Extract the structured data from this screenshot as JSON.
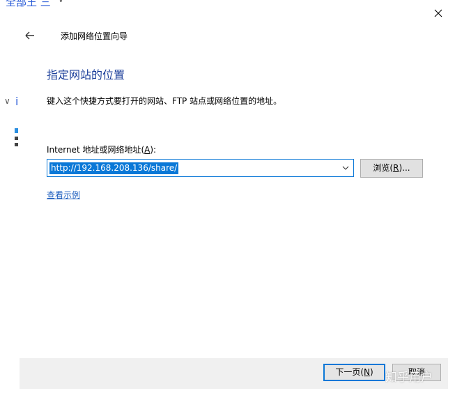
{
  "background_window": {
    "fragment_text": "全部王 三",
    "fragment_text_2": "i"
  },
  "dialog": {
    "title": "添加网络位置向导",
    "heading": "指定网站的位置",
    "instruction": "键入这个快捷方式要打开的网站、FTP 站点或网络位置的地址。",
    "address_label_before": "Internet 地址或网络地址(",
    "address_label_key": "A",
    "address_label_after": "):",
    "address_value": "http://192.168.208.136/share/",
    "browse_before": "浏览(",
    "browse_key": "R",
    "browse_after": ")...",
    "example_link": "查看示例",
    "next_before": "下一页(",
    "next_key": "N",
    "next_after": ")",
    "cancel_label": "取消"
  },
  "watermark": "知乎用户",
  "colors": {
    "accent": "#0a78d7",
    "heading": "#1b3e9a",
    "link": "#1f5fbf"
  },
  "icons": [
    "close-icon",
    "back-arrow-icon",
    "chevron-down-icon"
  ]
}
